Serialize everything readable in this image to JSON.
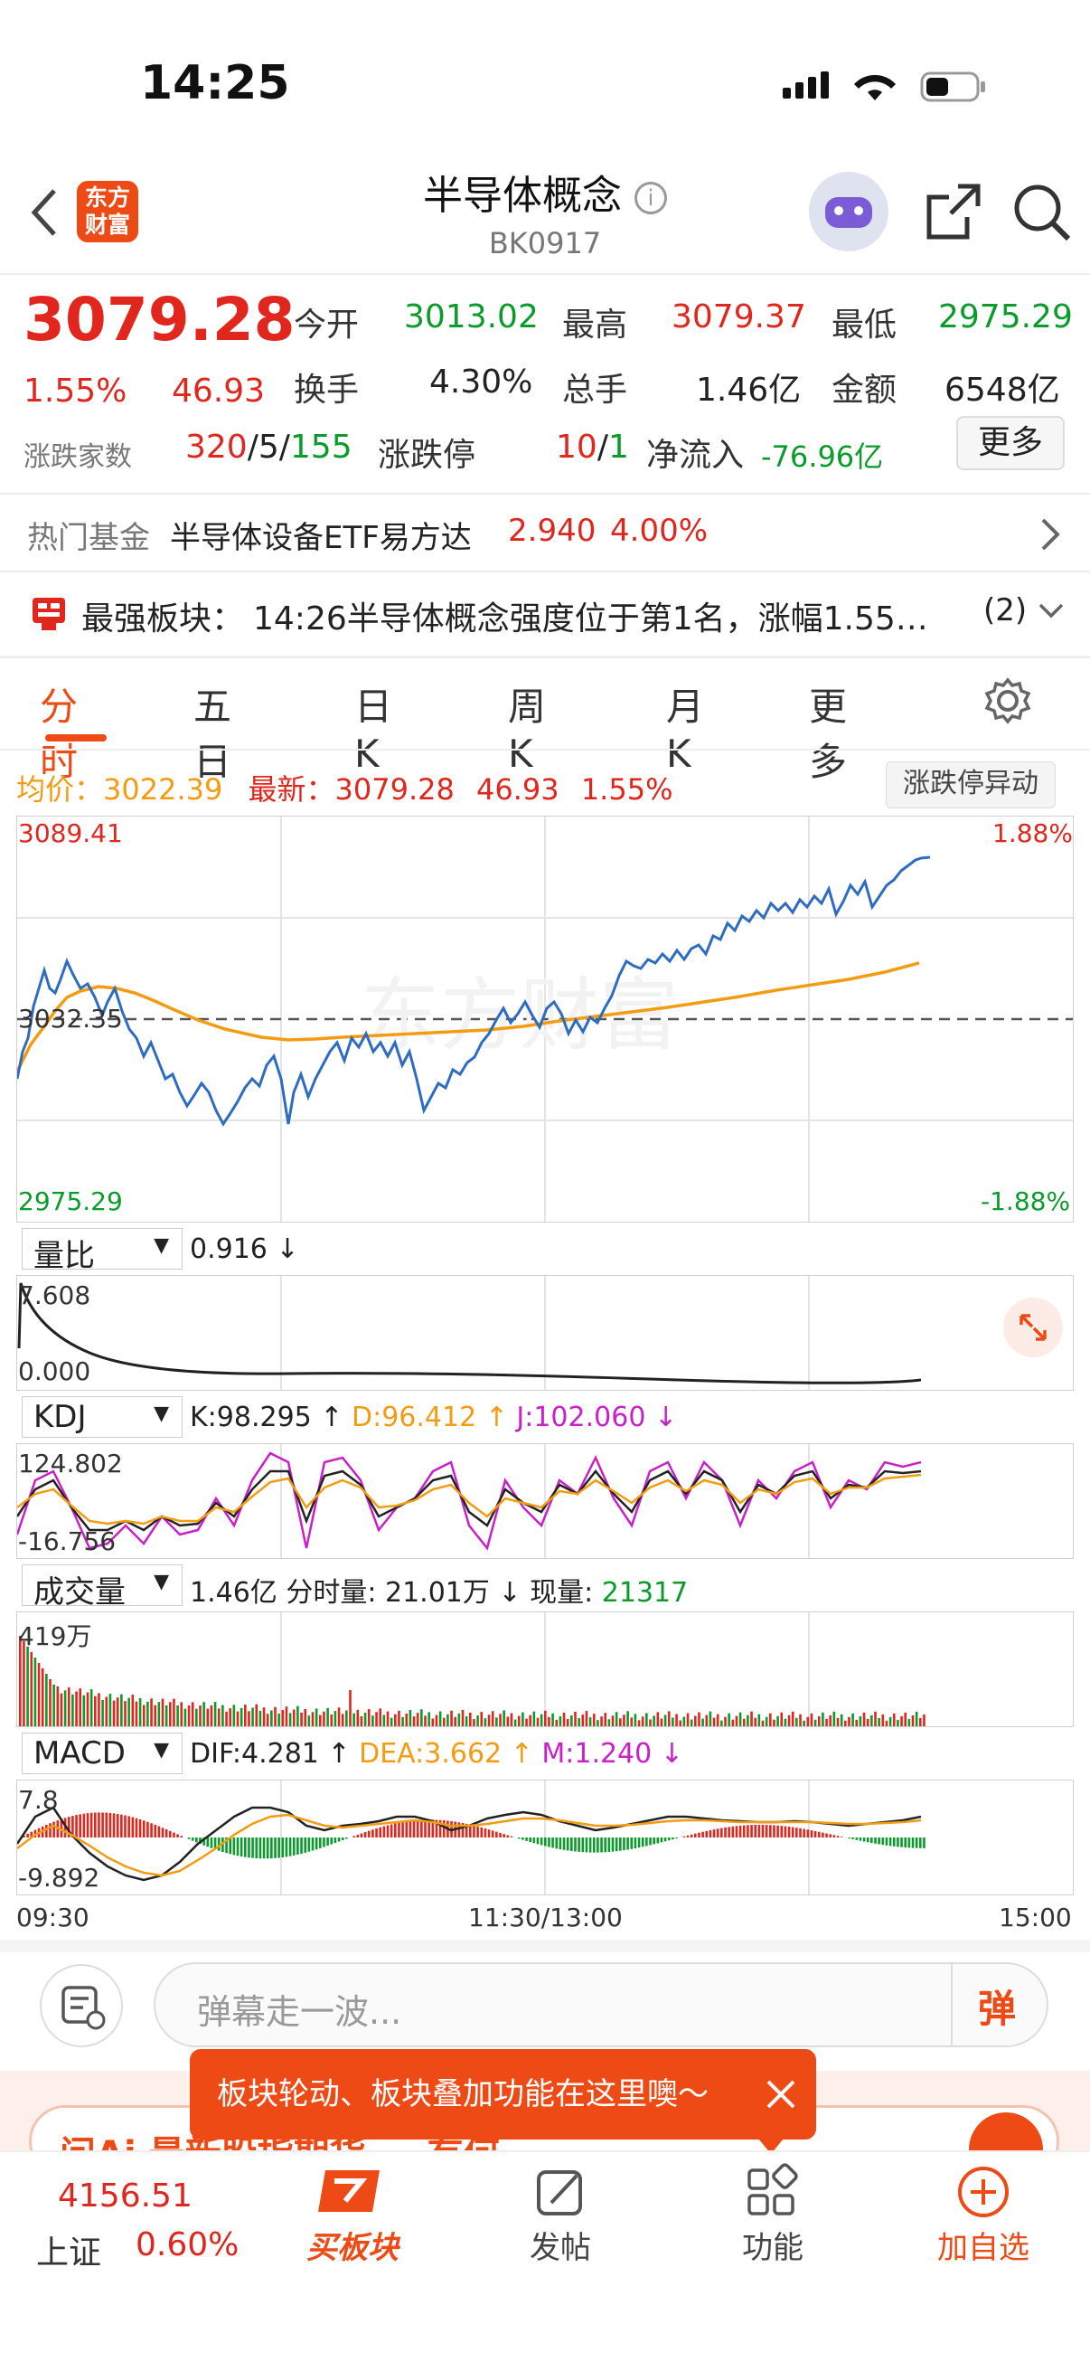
{
  "status": {
    "time": "14:25"
  },
  "header": {
    "logo_line1": "东方",
    "logo_line2": "财富",
    "title": "半导体概念",
    "code": "BK0917"
  },
  "quote": {
    "price": "3079.28",
    "pct": "1.55%",
    "chg": "46.93",
    "open_label": "今开",
    "open": "3013.02",
    "high_label": "最高",
    "high": "3079.37",
    "low_label": "最低",
    "low": "2975.29",
    "turnover_label": "换手",
    "turnover": "4.30%",
    "volume_label": "总手",
    "volume": "1.46亿",
    "amount_label": "金额",
    "amount": "6548亿",
    "breadth_label": "涨跌家数",
    "up": "320",
    "flat": "5",
    "down": "155",
    "limit_label": "涨跌停",
    "limit_up": "10",
    "limit_down": "1",
    "netflow_label": "净流入",
    "netflow": "-76.96亿",
    "more": "更多"
  },
  "fund": {
    "label": "热门基金",
    "name": "半导体设备ETF易方达",
    "price": "2.940",
    "pct": "4.00%"
  },
  "notice": {
    "label": "最强板块：",
    "text": "14:26半导体概念强度位于第1名，涨幅1.55…",
    "count": "(2)"
  },
  "tabs": [
    "分时",
    "五日",
    "日K",
    "周K",
    "月K",
    "更多"
  ],
  "summary": {
    "avg_label": "均价：",
    "avg": "3022.39",
    "latest_label": "最新：",
    "latest": "3079.28",
    "chg": "46.93",
    "pct": "1.55%",
    "limit_btn": "涨跌停异动"
  },
  "price_chart": {
    "max": "3089.41",
    "min": "2975.29",
    "mid": "3032.35",
    "max_pct": "1.88%",
    "min_pct": "-1.88%",
    "watermark": "东方财富"
  },
  "vr": {
    "sel": "量比",
    "val": "0.916 ↓",
    "top": "7.608",
    "bottom": "0.000"
  },
  "kdj": {
    "sel": "KDJ",
    "k": "K:98.295 ↑",
    "d": "D:96.412 ↑",
    "j": "J:102.060 ↓",
    "top": "124.802",
    "bottom": "-16.756"
  },
  "vol": {
    "sel": "成交量",
    "total": "1.46亿",
    "fs_label": "分时量:",
    "fs": "21.01万 ↓",
    "now_label": "现量:",
    "now": "21317",
    "top": "419万"
  },
  "macd": {
    "sel": "MACD",
    "dif": "DIF:4.281 ↑",
    "dea": "DEA:3.662 ↑",
    "m": "M:1.240 ↓",
    "top": "7.8",
    "bottom": "-9.892"
  },
  "time_axis": {
    "start": "09:30",
    "mid": "11:30/13:00",
    "end": "15:00"
  },
  "danmu": {
    "placeholder": "弹幕走一波...",
    "btn": "弹"
  },
  "tip": {
    "text": "板块轮动、板块叠加功能在这里噢～"
  },
  "ai_banner": {
    "text": "问Ai 最新股指期货 … 有何"
  },
  "bottom": {
    "index_value": "4156.51",
    "index_name": "上证",
    "index_pct": "0.60%",
    "buy": "买板块",
    "post": "发帖",
    "func": "功能",
    "add": "加自选"
  },
  "colors": {
    "accent": "#ee4a16",
    "up": "#e0261d",
    "down": "#0a9c2a",
    "price_line": "#2d6cc0",
    "avg_line": "#f39c12"
  }
}
